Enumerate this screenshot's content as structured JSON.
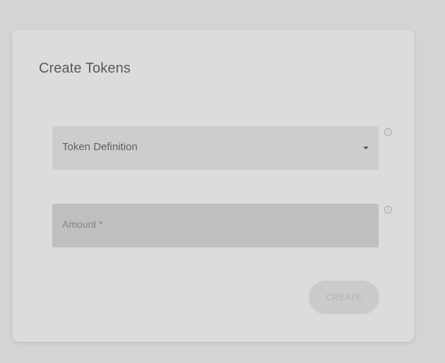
{
  "card": {
    "title": "Create Tokens"
  },
  "form": {
    "token_definition": {
      "label": "Token Definition",
      "icon": "chevron-down-icon"
    },
    "amount": {
      "placeholder": "Amount *"
    },
    "info_icon": "info-icon",
    "create_label": "CREATE"
  },
  "colors": {
    "background": "#d4d4d4",
    "card": "#dcdcdc",
    "select_field": "#cdcdcd",
    "amount_field": "#bfbfbf",
    "button": "#cbcbcb",
    "button_text": "#b0b0b0"
  }
}
